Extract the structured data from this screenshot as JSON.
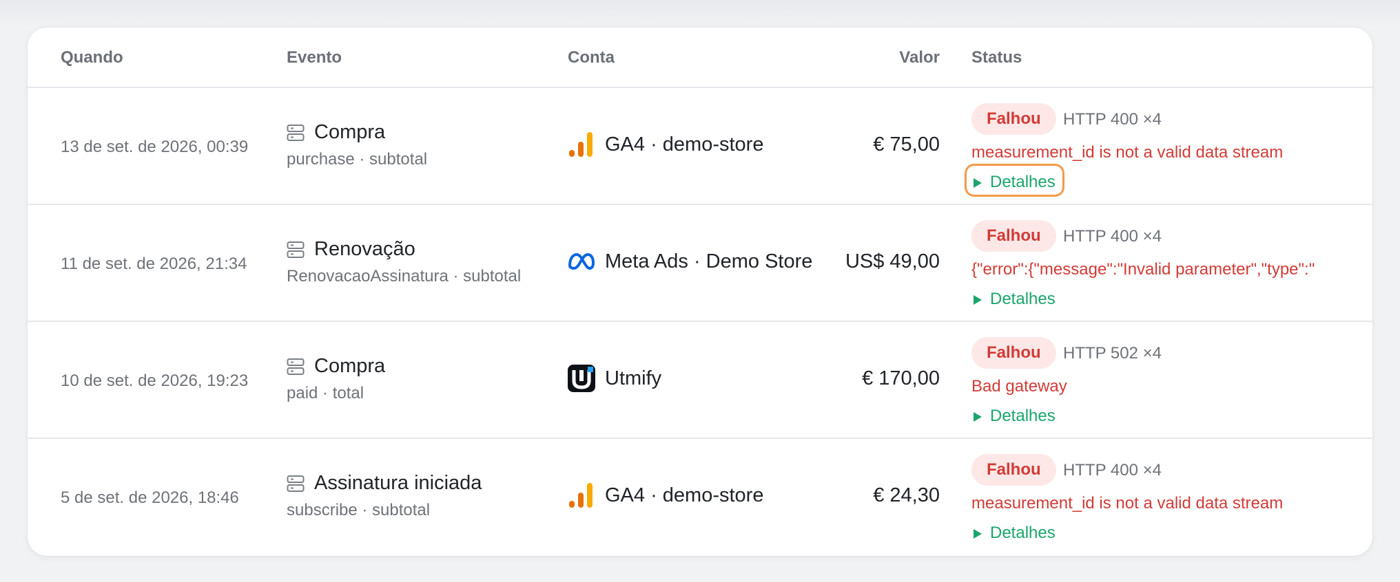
{
  "table": {
    "headers": {
      "when": "Quando",
      "event": "Evento",
      "account": "Conta",
      "value": "Valor",
      "status": "Status"
    },
    "rows": [
      {
        "when": "13 de set. de 2026, 00:39",
        "event_title": "Compra",
        "event_sub": "purchase · subtotal",
        "account_logo": "ga4-logo-icon",
        "account": "GA4 · demo-store",
        "value": "€ 75,00",
        "status": "Falhou",
        "http": "HTTP 400  ×4",
        "error": "measurement_id is not a valid data stream",
        "details": "Detalhes"
      },
      {
        "when": "11 de set. de 2026, 21:34",
        "event_title": "Renovação",
        "event_sub": "RenovacaoAssinatura · subtotal",
        "account_logo": "meta-logo-icon",
        "account": "Meta Ads · Demo Store",
        "value": "US$ 49,00",
        "status": "Falhou",
        "http": "HTTP 400  ×4",
        "error": "{\"error\":{\"message\":\"Invalid parameter\",\"type\":\"",
        "details": "Detalhes"
      },
      {
        "when": "10 de set. de 2026, 19:23",
        "event_title": "Compra",
        "event_sub": "paid · total",
        "account_logo": "utmify-logo-icon",
        "account": "Utmify",
        "value": "€ 170,00",
        "status": "Falhou",
        "http": "HTTP 502  ×4",
        "error": "Bad gateway",
        "details": "Detalhes"
      },
      {
        "when": "5 de set. de 2026, 18:46",
        "event_title": "Assinatura iniciada",
        "event_sub": "subscribe · subtotal",
        "account_logo": "ga4-logo-icon",
        "account": "GA4 · demo-store",
        "value": "€ 24,30",
        "status": "Falhou",
        "http": "HTTP 400  ×4",
        "error": "measurement_id is not a valid data stream",
        "details": "Detalhes"
      }
    ]
  },
  "colors": {
    "error": "#d23b36",
    "badge_bg": "#fde8e7",
    "details": "#1aa56b",
    "focus_ring": "#f39a4a",
    "ga4_orange": "#e8710a",
    "ga4_yellow": "#f9ab00",
    "meta_blue": "#0a66e0"
  },
  "icons": {
    "event": "server-icon",
    "details": "play-triangle-icon"
  }
}
